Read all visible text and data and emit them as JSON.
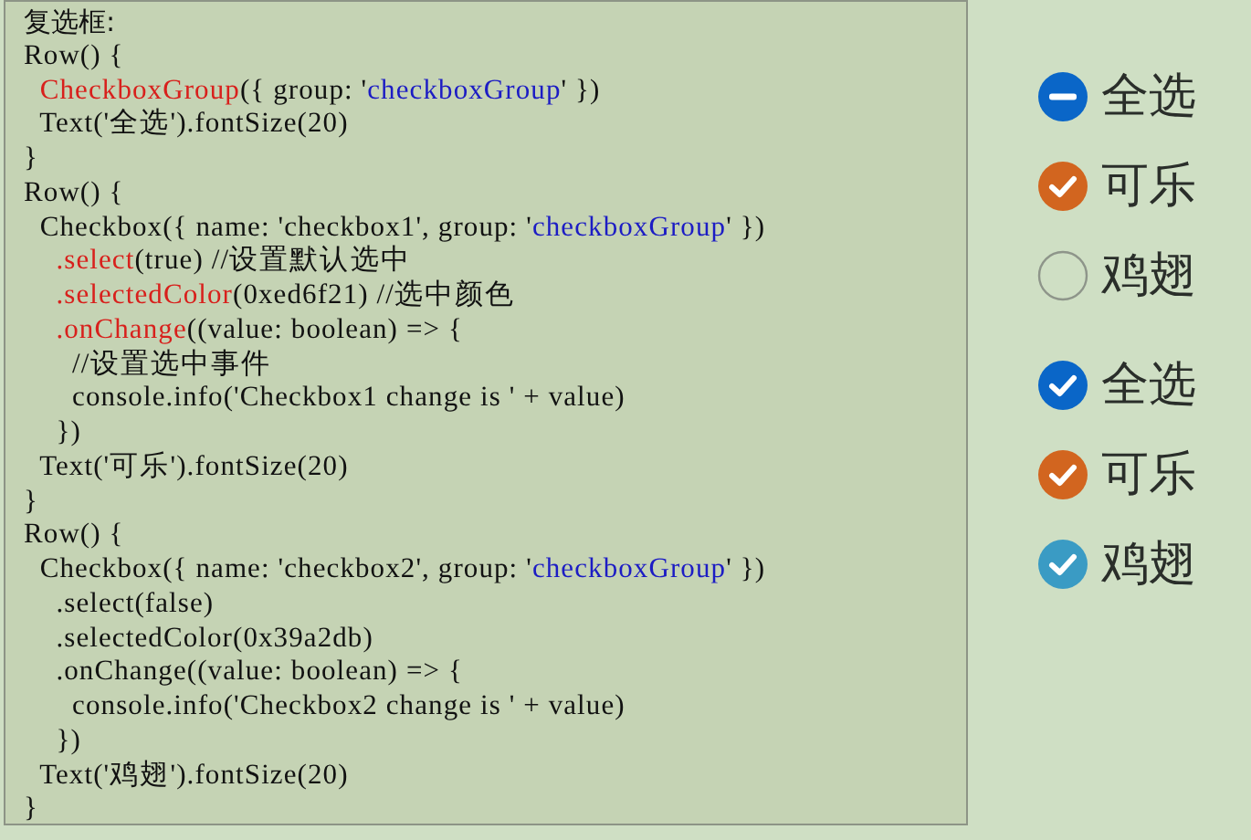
{
  "code_panel": {
    "title": "复选框:",
    "lines": [
      [
        {
          "kind": "plain",
          "text": "Row() {"
        }
      ],
      [
        {
          "kind": "keyword",
          "text": "  CheckboxGroup"
        },
        {
          "kind": "plain",
          "text": "({ group: '"
        },
        {
          "kind": "string",
          "text": "checkboxGroup"
        },
        {
          "kind": "plain",
          "text": "' })"
        }
      ],
      [
        {
          "kind": "plain",
          "text": "  Text('全选').fontSize(20)"
        }
      ],
      [
        {
          "kind": "plain",
          "text": "}"
        }
      ],
      [
        {
          "kind": "plain",
          "text": "Row() {"
        }
      ],
      [
        {
          "kind": "plain",
          "text": "  Checkbox({ name: 'checkbox1', group: '"
        },
        {
          "kind": "string",
          "text": "checkboxGroup"
        },
        {
          "kind": "plain",
          "text": "' })"
        }
      ],
      [
        {
          "kind": "keyword",
          "text": "    .select"
        },
        {
          "kind": "plain",
          "text": "(true) //设置默认选中"
        }
      ],
      [
        {
          "kind": "keyword",
          "text": "    .selectedColor"
        },
        {
          "kind": "plain",
          "text": "(0xed6f21) //选中颜色"
        }
      ],
      [
        {
          "kind": "keyword",
          "text": "    .onChange"
        },
        {
          "kind": "plain",
          "text": "((value: boolean) => {"
        }
      ],
      [
        {
          "kind": "plain",
          "text": "      //设置选中事件"
        }
      ],
      [
        {
          "kind": "plain",
          "text": "      console.info('Checkbox1 change is ' + value)"
        }
      ],
      [
        {
          "kind": "plain",
          "text": "    })"
        }
      ],
      [
        {
          "kind": "plain",
          "text": "  Text('可乐').fontSize(20)"
        }
      ],
      [
        {
          "kind": "plain",
          "text": "}"
        }
      ],
      [
        {
          "kind": "plain",
          "text": "Row() {"
        }
      ],
      [
        {
          "kind": "plain",
          "text": "  Checkbox({ name: 'checkbox2', group: '"
        },
        {
          "kind": "string",
          "text": "checkboxGroup"
        },
        {
          "kind": "plain",
          "text": "' })"
        }
      ],
      [
        {
          "kind": "plain",
          "text": "    .select(false)"
        }
      ],
      [
        {
          "kind": "plain",
          "text": "    .selectedColor(0x39a2db)"
        }
      ],
      [
        {
          "kind": "plain",
          "text": "    .onChange((value: boolean) => {"
        }
      ],
      [
        {
          "kind": "plain",
          "text": "      console.info('Checkbox2 change is ' + value)"
        }
      ],
      [
        {
          "kind": "plain",
          "text": "    })"
        }
      ],
      [
        {
          "kind": "plain",
          "text": "  Text('鸡翅').fontSize(20)"
        }
      ],
      [
        {
          "kind": "plain",
          "text": "}"
        }
      ]
    ]
  },
  "previews": [
    {
      "items": [
        {
          "label": "全选",
          "checked": false,
          "partial": true,
          "color": "#0a66c8"
        },
        {
          "label": "可乐",
          "checked": true,
          "partial": false,
          "color": "#d2651f"
        },
        {
          "label": "鸡翅",
          "checked": false,
          "partial": false
        }
      ]
    },
    {
      "items": [
        {
          "label": "全选",
          "checked": true,
          "partial": false,
          "color": "#0a66c8"
        },
        {
          "label": "可乐",
          "checked": true,
          "partial": false,
          "color": "#d2651f"
        },
        {
          "label": "鸡翅",
          "checked": true,
          "partial": false,
          "color": "#3a9bc4"
        }
      ]
    }
  ]
}
